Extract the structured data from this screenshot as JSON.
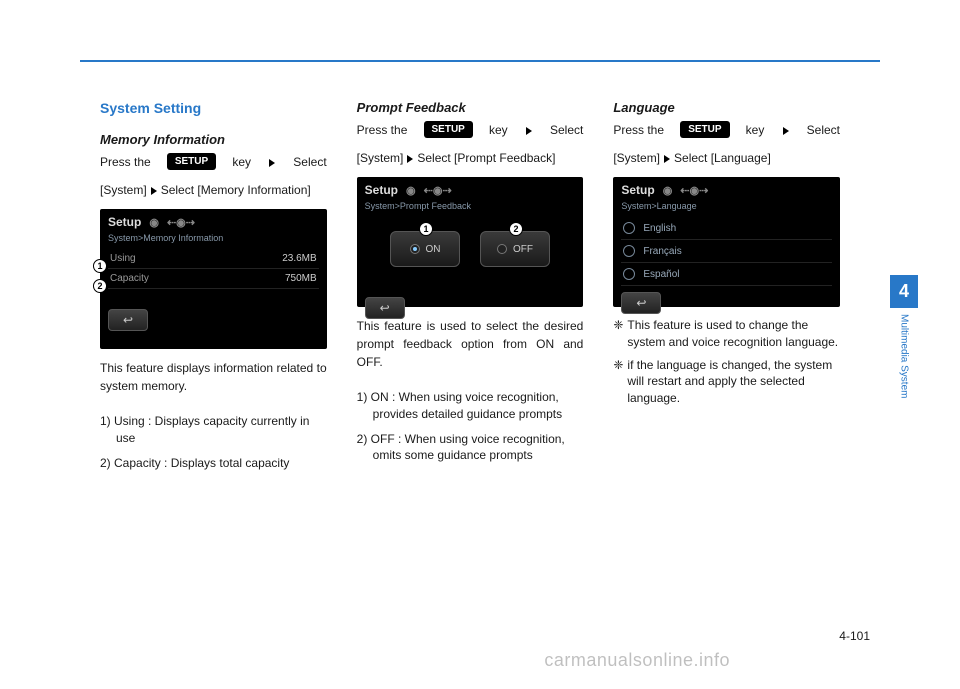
{
  "heading": "System Setting",
  "setup_label": "SETUP",
  "memory": {
    "title": "Memory Information",
    "press_prefix": "Press the ",
    "press_key": "key",
    "press_select": "Select",
    "crumb1": "[System]",
    "crumb2": "Select [Memory Information]",
    "screen": {
      "title": "Setup",
      "breadcrumb": "System>Memory Information",
      "row1_label": "Using",
      "row1_value": "23.6MB",
      "row2_label": "Capacity",
      "row2_value": "750MB"
    },
    "desc": "This feature displays information related to system memory.",
    "items": [
      "1) Using : Displays capacity currently in use",
      "2) Capacity : Displays total capacity"
    ]
  },
  "prompt": {
    "title": "Prompt Feedback",
    "press_prefix": "Press the ",
    "press_key": "key",
    "press_select": "Select",
    "crumb1": "[System]",
    "crumb2": "Select [Prompt Feedback]",
    "screen": {
      "title": "Setup",
      "breadcrumb": "System>Prompt Feedback",
      "on": "ON",
      "off": "OFF"
    },
    "desc": "This feature is used to select the desired prompt feedback option from ON and OFF.",
    "items": [
      "1) ON : When using voice recognition, provides detailed guidance prompts",
      "2) OFF : When using voice recognition, omits some guidance prompts"
    ]
  },
  "language": {
    "title": "Language",
    "press_prefix": "Press the ",
    "press_key": "key",
    "press_select": "Select",
    "crumb1": "[System]",
    "crumb2": "Select [Language]",
    "screen": {
      "title": "Setup",
      "breadcrumb": "System>Language",
      "langs": [
        "English",
        "Français",
        "Español"
      ]
    },
    "bullets": [
      "This feature is used to change the system and voice recognition language.",
      "if the language is changed, the system will restart and apply the selected language."
    ],
    "bullet_symbol": "❈"
  },
  "chapter_num": "4",
  "chapter_label": "Multimedia System",
  "page_number": "4-101",
  "watermark": "carmanualsonline.info",
  "annotations": {
    "one": "1",
    "two": "2"
  }
}
